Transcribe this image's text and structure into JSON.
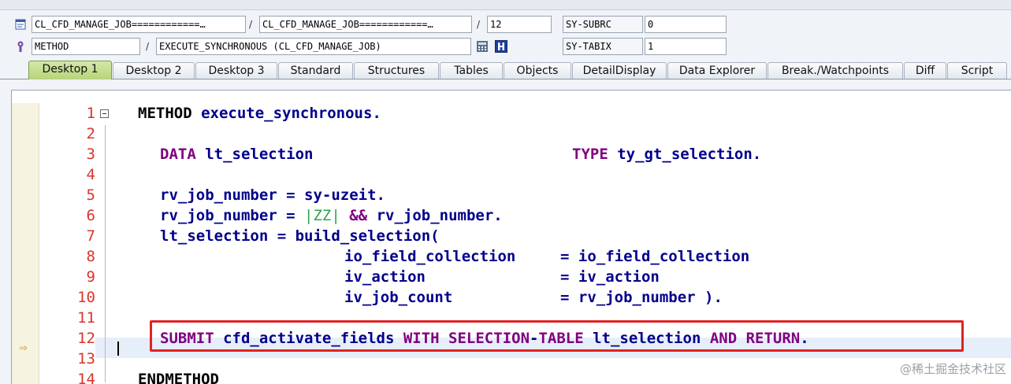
{
  "fields": {
    "row1": {
      "class_a": "CL_CFD_MANAGE_JOB============…",
      "class_b": "CL_CFD_MANAGE_JOB============…",
      "line": "12",
      "var_name": "SY-SUBRC",
      "var_value": "0"
    },
    "row2": {
      "type": "METHOD",
      "method": "EXECUTE_SYNCHRONOUS (CL_CFD_MANAGE_JOB)",
      "var_name": "SY-TABIX",
      "var_value": "1"
    },
    "slash": "/"
  },
  "tabs": [
    "Desktop 1",
    "Desktop 2",
    "Desktop 3",
    "Standard",
    "Structures",
    "Tables",
    "Objects",
    "DetailDisplay",
    "Data Explorer",
    "Break./Watchpoints",
    "Diff",
    "Script"
  ],
  "active_tab": "Desktop 1",
  "code": {
    "lines": [
      {
        "n": "1"
      },
      {
        "n": "2"
      },
      {
        "n": "3"
      },
      {
        "n": "4"
      },
      {
        "n": "5"
      },
      {
        "n": "6"
      },
      {
        "n": "7"
      },
      {
        "n": "8"
      },
      {
        "n": "9"
      },
      {
        "n": "10"
      },
      {
        "n": "11"
      },
      {
        "n": "12"
      },
      {
        "n": "13"
      },
      {
        "n": "14"
      }
    ],
    "l1_kw": "METHOD",
    "l1_rest": " execute_synchronous.",
    "l3_kw": "DATA",
    "l3_name": " lt_selection",
    "l3_kw2": "TYPE",
    "l3_type": " ty_gt_selection.",
    "l5": "rv_job_number = sy-uzeit.",
    "l6_a": "rv_job_number = ",
    "l6_lit": "|ZZ|",
    "l6_op": " && ",
    "l6_b": "rv_job_number.",
    "l7": "lt_selection = build_selection(",
    "l8_a": "io_field_collection",
    "l8_b": "= io_field_collection",
    "l9_a": "iv_action",
    "l9_b": "= iv_action",
    "l10_a": "iv_job_count",
    "l10_b": "= rv_job_number ).",
    "l12_kw1": "SUBMIT",
    "l12_a": " cfd_activate_fields ",
    "l12_kw2": "WITH SELECTION",
    "l12_dash": "-",
    "l12_kw3": "TABLE",
    "l12_b": " lt_selection ",
    "l12_kw4": "AND RETURN",
    "l12_c": ".",
    "l14_kw": "ENDMETHOD"
  },
  "watermark": "@稀土掘金技术社区"
}
